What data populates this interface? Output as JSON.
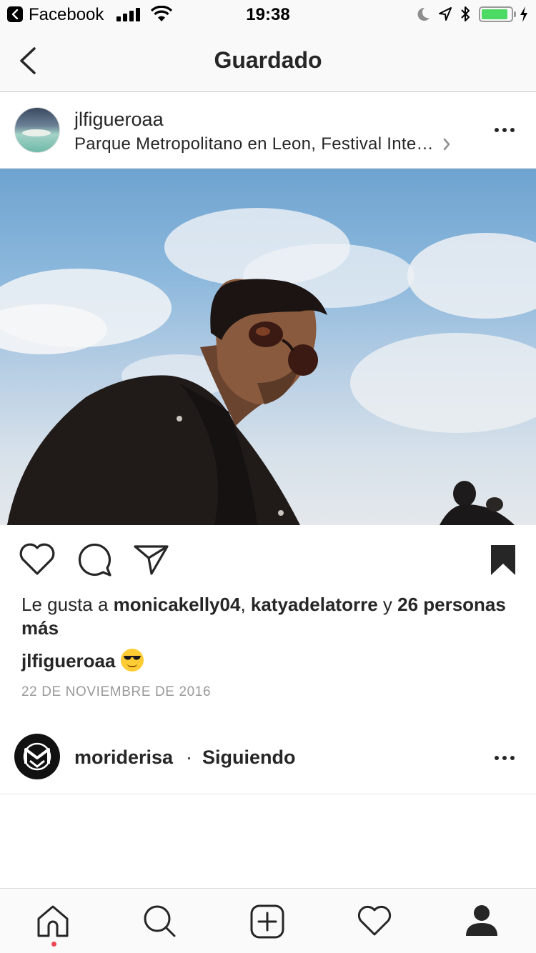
{
  "status_bar": {
    "back_app": "Facebook",
    "time": "19:38",
    "battery_level": 0.9,
    "battery_color": "#4cd964"
  },
  "nav": {
    "title": "Guardado",
    "back_icon": "chevron-left-icon"
  },
  "post": {
    "username": "jlfigueroaa",
    "location": "Parque Metropolitano en Leon, Festival Internacional del Globo",
    "actions": [
      "heart-icon",
      "comment-icon",
      "share-icon",
      "bookmark-icon"
    ],
    "likes": {
      "prefix": "Le gusta a ",
      "user1": "monicakelly04",
      "sep": ", ",
      "user2": "katyadelatorre",
      "and": " y ",
      "others": "26 personas más"
    },
    "caption_user": "jlfigueroaa",
    "caption_emoji": "smiling-face-with-sunglasses-emoji",
    "date": "22 DE NOVIEMBRE DE 2016"
  },
  "next_post": {
    "username": "moriderisa",
    "separator": "·",
    "follow_status": "Siguiendo"
  },
  "tab_bar": {
    "items": [
      "home-icon",
      "search-icon",
      "add-icon",
      "activity-icon",
      "profile-icon"
    ],
    "notification_color": "#ed4956"
  }
}
